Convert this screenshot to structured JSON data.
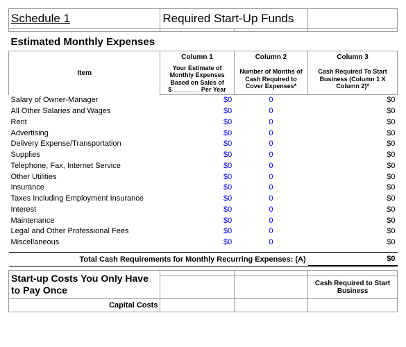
{
  "title": {
    "schedule": "Schedule 1",
    "heading": "Required Start-Up Funds"
  },
  "section1_heading": "Estimated Monthly Expenses",
  "headers": {
    "item": "Item",
    "col1": "Column 1",
    "col2": "Column 2",
    "col3": "Column 3",
    "sub1": "Your Estimate of Monthly Expenses Based on Sales of $________ Per Year",
    "sub2": "Number of Months of Cash Required to Cover Expenses*",
    "sub3": "Cash Required To Start Business (Column 1 X Column 2)*"
  },
  "rows": [
    {
      "item": "Salary of Owner-Manager",
      "c1": "$0",
      "c2": "0",
      "c3": "$0"
    },
    {
      "item": "All Other Salaries and Wages",
      "c1": "$0",
      "c2": "0",
      "c3": "$0"
    },
    {
      "item": "Rent",
      "c1": "$0",
      "c2": "0",
      "c3": "$0"
    },
    {
      "item": "Advertising",
      "c1": "$0",
      "c2": "0",
      "c3": "$0"
    },
    {
      "item": "Delivery Expense/Transportation",
      "c1": "$0",
      "c2": "0",
      "c3": "$0"
    },
    {
      "item": "Supplies",
      "c1": "$0",
      "c2": "0",
      "c3": "$0"
    },
    {
      "item": "Telephone, Fax, Internet Service",
      "c1": "$0",
      "c2": "0",
      "c3": "$0"
    },
    {
      "item": "Other Utilities",
      "c1": "$0",
      "c2": "0",
      "c3": "$0"
    },
    {
      "item": "Insurance",
      "c1": "$0",
      "c2": "0",
      "c3": "$0"
    },
    {
      "item": "Taxes Including Employment Insurance",
      "c1": "$0",
      "c2": "0",
      "c3": "$0"
    },
    {
      "item": "Interest",
      "c1": "$0",
      "c2": "0",
      "c3": "$0"
    },
    {
      "item": "Maintenance",
      "c1": "$0",
      "c2": "0",
      "c3": "$0"
    },
    {
      "item": "Legal and Other Professional Fees",
      "c1": "$0",
      "c2": "0",
      "c3": "$0"
    },
    {
      "item": "Miscellaneous",
      "c1": "$0",
      "c2": "0",
      "c3": "$0"
    }
  ],
  "total": {
    "label": "Total Cash Requirements for Monthly Recurring Expenses: (A)",
    "value": "$0"
  },
  "section2": {
    "heading": "Start-up Costs You Only Have to Pay Once",
    "col3_label": "Cash Required to Start Business",
    "capital": "Capital Costs"
  }
}
